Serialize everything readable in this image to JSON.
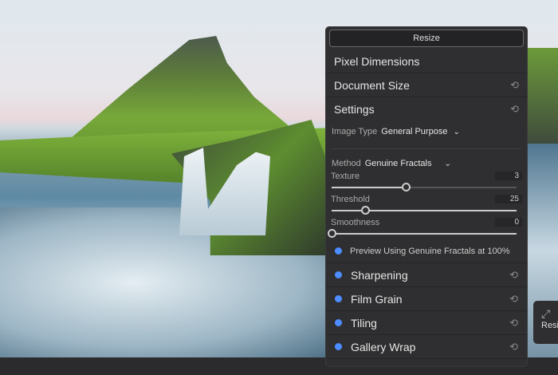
{
  "panel": {
    "title": "Resize",
    "sections": [
      {
        "label": "Pixel Dimensions"
      },
      {
        "label": "Document Size"
      },
      {
        "label": "Settings"
      }
    ],
    "image_type": {
      "label": "Image Type",
      "value": "General Purpose"
    },
    "method": {
      "label": "Method",
      "value": "Genuine Fractals"
    },
    "sliders": [
      {
        "label": "Texture",
        "value": "3",
        "fraction": 0.4
      },
      {
        "label": "Threshold",
        "value": "25",
        "fraction": 0.18
      },
      {
        "label": "Smoothness",
        "value": "0",
        "fraction": 0.0
      }
    ],
    "preview_label": "Preview Using Genuine Fractals at 100%",
    "features": [
      {
        "label": "Sharpening"
      },
      {
        "label": "Film Grain"
      },
      {
        "label": "Tiling"
      },
      {
        "label": "Gallery Wrap"
      }
    ]
  },
  "side_button": {
    "label": "Resi"
  },
  "colors": {
    "accent": "#4c8dff",
    "panel": "#2f2f31"
  }
}
